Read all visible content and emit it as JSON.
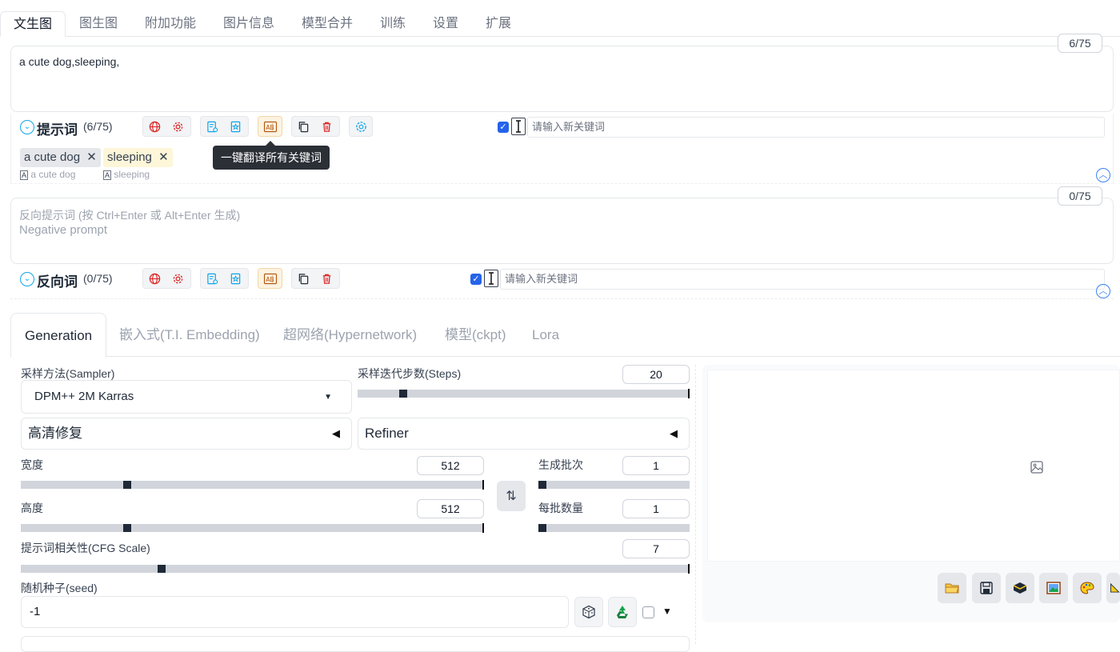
{
  "tabs": [
    "文生图",
    "图生图",
    "附加功能",
    "图片信息",
    "模型合并",
    "训练",
    "设置",
    "扩展"
  ],
  "positive": {
    "text": "a cute dog,sleeping,",
    "counter": "6/75",
    "label": "提示词",
    "count": "(6/75)",
    "keyword_placeholder": "请输入新关键词",
    "tags": [
      {
        "text": "a cute dog",
        "sub": "a cute dog"
      },
      {
        "text": "sleeping",
        "sub": "sleeping"
      }
    ],
    "tooltip": "一键翻译所有关键词"
  },
  "negative": {
    "placeholder_line1": "反向提示词 (按 Ctrl+Enter 或 Alt+Enter 生成)",
    "placeholder_line2": "Negative prompt",
    "counter": "0/75",
    "label": "反向词",
    "count": "(0/75)",
    "keyword_placeholder": "请输入新关键词"
  },
  "gen_tabs": [
    "Generation",
    "嵌入式(T.I. Embedding)",
    "超网络(Hypernetwork)",
    "模型(ckpt)",
    "Lora"
  ],
  "generation": {
    "sampler_label": "采样方法(Sampler)",
    "sampler_value": "DPM++ 2M Karras",
    "steps_label": "采样迭代步数(Steps)",
    "steps_value": "20",
    "hires_label": "高清修复",
    "refiner_label": "Refiner",
    "width_label": "宽度",
    "width_value": "512",
    "height_label": "高度",
    "height_value": "512",
    "batch_count_label": "生成批次",
    "batch_count_value": "1",
    "batch_size_label": "每批数量",
    "batch_size_value": "1",
    "cfg_label": "提示词相关性(CFG Scale)",
    "cfg_value": "7",
    "seed_label": "随机种子(seed)",
    "seed_value": "-1"
  },
  "icons": {
    "translate": "globe-icon",
    "settings": "gear-icon",
    "history": "history-icon",
    "bookmark": "bookmark-icon",
    "translate_all": "translate-icon",
    "copy": "copy-icon",
    "delete": "trash-icon",
    "openai": "openai-icon",
    "dice": "dice-icon",
    "recycle": "recycle-icon",
    "image_placeholder": "image-icon"
  },
  "colors": {
    "accent": "#2563eb",
    "danger": "#dc2626",
    "sky": "#0ea5e9"
  }
}
